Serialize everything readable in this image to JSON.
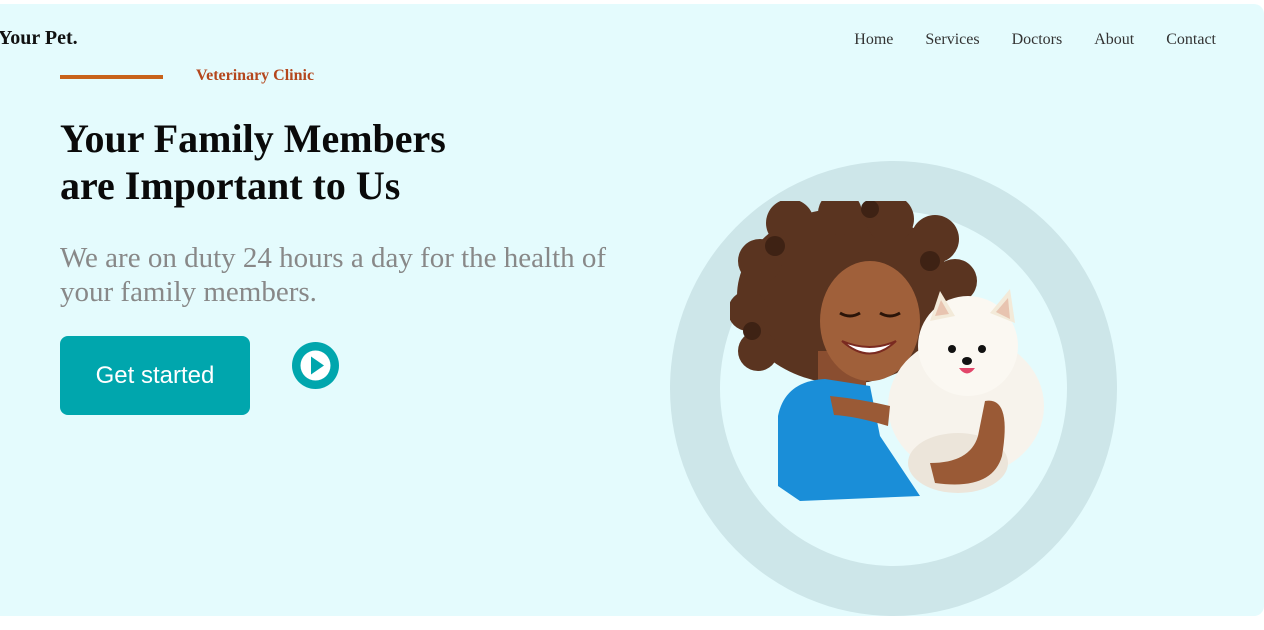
{
  "brand": {
    "name": "Your Pet."
  },
  "nav": {
    "items": [
      {
        "label": "Home"
      },
      {
        "label": "Services"
      },
      {
        "label": "Doctors"
      },
      {
        "label": "About"
      },
      {
        "label": "Contact"
      }
    ]
  },
  "hero": {
    "eyebrow": "Veterinary Clinic",
    "headline_line1": "Your Family Members",
    "headline_line2": "are Important to Us",
    "subtext": "We are on duty 24 hours a day for the health of your family members.",
    "cta_label": "Get started",
    "play_icon": "play-icon",
    "image_icon": "woman-hugging-dog-photo"
  },
  "colors": {
    "background": "#e4fbfd",
    "accent": "#00a6ad",
    "eyebrow": "#b4471d",
    "accent_line": "#c8621a",
    "ring": "#cde6e9",
    "subtext": "#888888"
  }
}
